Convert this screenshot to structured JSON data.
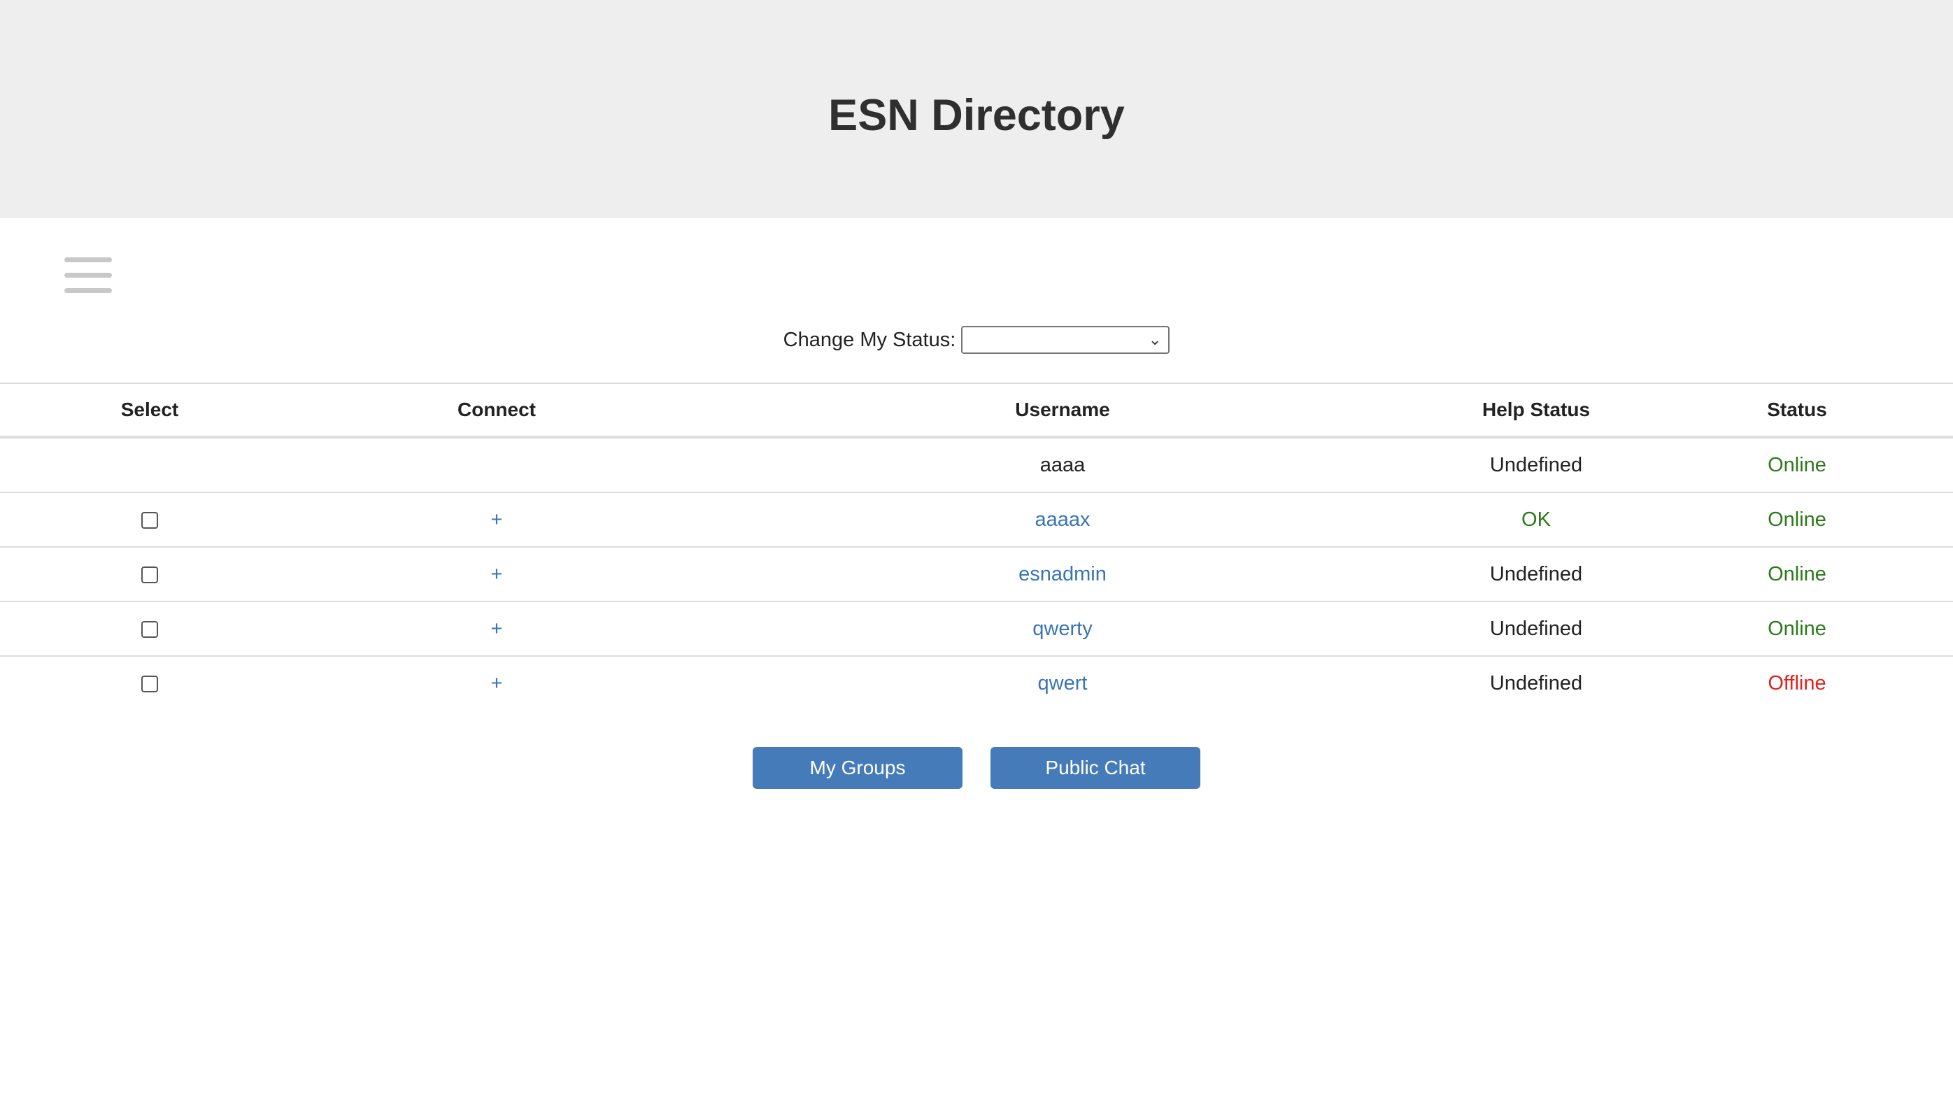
{
  "header": {
    "title": "ESN Directory"
  },
  "menu": {
    "icon": "hamburger-menu-icon"
  },
  "status_control": {
    "label": "Change My Status:",
    "selected_value": "",
    "chevron": "⌄"
  },
  "table": {
    "columns": [
      "Select",
      "Connect",
      "Username",
      "Help Status",
      "Status"
    ],
    "rows": [
      {
        "username": "aaaa",
        "connect": "",
        "help_status": "Undefined",
        "status": "Online",
        "selectable": false
      },
      {
        "username": "aaaax",
        "connect": "+",
        "help_status": "OK",
        "status": "Online",
        "selectable": true
      },
      {
        "username": "esnadmin",
        "connect": "+",
        "help_status": "Undefined",
        "status": "Online",
        "selectable": true
      },
      {
        "username": "qwerty",
        "connect": "+",
        "help_status": "Undefined",
        "status": "Online",
        "selectable": true
      },
      {
        "username": "qwert",
        "connect": "+",
        "help_status": "Undefined",
        "status": "Offline",
        "selectable": true
      }
    ]
  },
  "buttons": {
    "my_groups": "My Groups",
    "public_chat": "Public Chat"
  },
  "colors": {
    "header_bg": "#eeeeee",
    "link": "#3a74b4",
    "online": "#2c7a1a",
    "offline": "#e0231c",
    "help_ok": "#2c7a1a",
    "button_bg": "#447bb8"
  }
}
